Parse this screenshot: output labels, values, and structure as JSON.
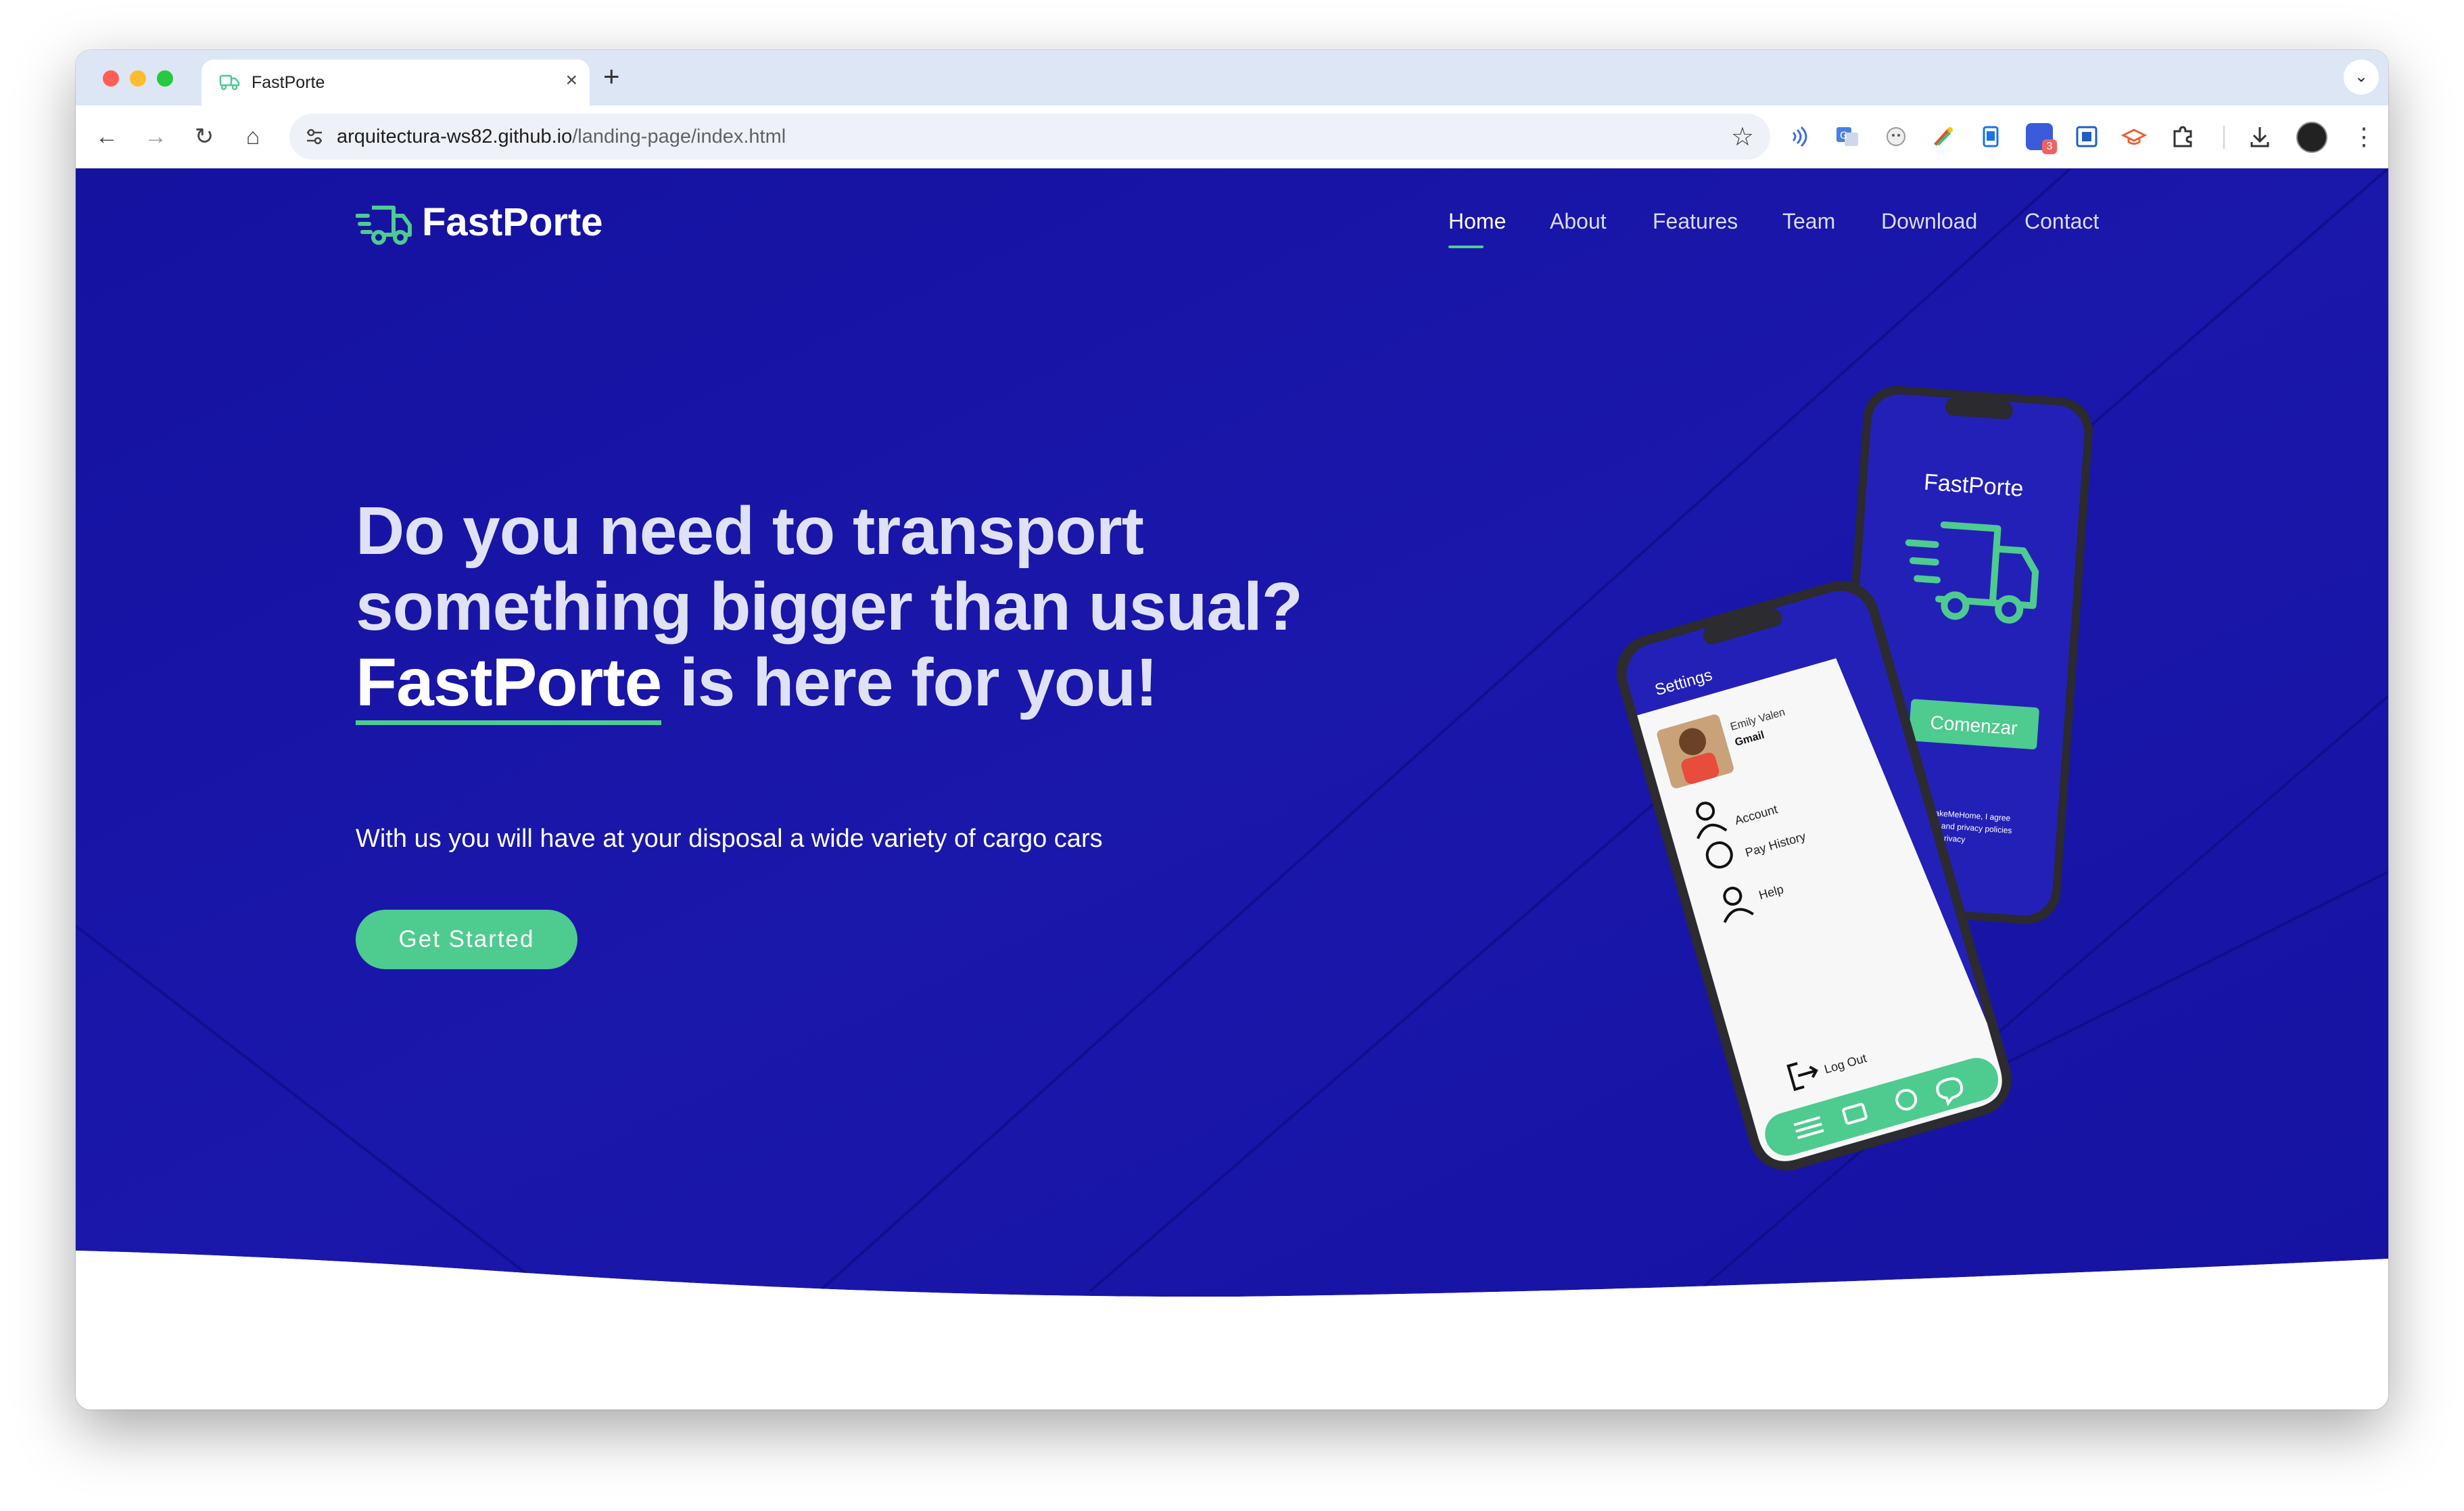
{
  "browser": {
    "tab": {
      "title": "FastPorte",
      "close": "×"
    },
    "new_tab": "+",
    "tab_menu": "⌄",
    "nav": {
      "back": "←",
      "forward": "→",
      "reload": "↻",
      "home": "⌂"
    },
    "url": {
      "host": "arquitectura-ws82.github.io",
      "path": "/landing-page/index.html"
    },
    "star": "☆",
    "extension_badge": "3",
    "more": "⋮"
  },
  "site": {
    "brand": "FastPorte",
    "nav": [
      {
        "label": "Home",
        "active": true
      },
      {
        "label": "About"
      },
      {
        "label": "Features"
      },
      {
        "label": "Team"
      },
      {
        "label": "Download"
      },
      {
        "label": "Contact"
      }
    ],
    "hero": {
      "headline_before": "Do you need to transport something bigger than usual? ",
      "headline_brand": "FastPorte",
      "headline_after": " is here for you!",
      "subtitle": "With us you will have at your disposal a wide variety of cargo cars",
      "cta": "Get Started"
    },
    "phone_back": {
      "title": "FastPorte",
      "button": "Comenzar",
      "terms_1": "By using TakeMeHome, I agree",
      "terms_2": "terms of use and privacy policies",
      "terms_3": "privacy"
    },
    "phone_front": {
      "header": "Settings",
      "user_name": "Emily Valen",
      "user_email": "Gmail",
      "menu": [
        "Account",
        "Pay History",
        "Help"
      ],
      "logout": "Log Out"
    }
  },
  "colors": {
    "hero_bg": "#1a17a8",
    "accent": "#4ecb8f",
    "tab_strip": "#dde6f5"
  }
}
